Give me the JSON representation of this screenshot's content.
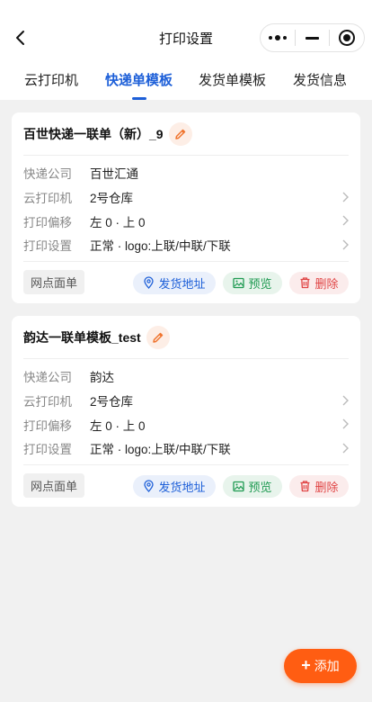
{
  "header": {
    "title": "打印设置"
  },
  "tabs": [
    {
      "label": "云打印机",
      "active": false
    },
    {
      "label": "快递单模板",
      "active": true
    },
    {
      "label": "发货单模板",
      "active": false
    },
    {
      "label": "发货信息",
      "active": false
    }
  ],
  "field_labels": {
    "courier": "快递公司",
    "printer": "云打印机",
    "offset": "打印偏移",
    "settings": "打印设置"
  },
  "templates": [
    {
      "title": "百世快递一联单（新）_9",
      "courier": "百世汇通",
      "printer": "2号仓库",
      "offset": "左 0 · 上 0",
      "settings": "正常 · logo:上联/中联/下联",
      "tag": "网点面单",
      "address_btn": "发货地址",
      "preview_btn": "预览",
      "delete_btn": "删除"
    },
    {
      "title": "韵达一联单模板_test",
      "courier": "韵达",
      "printer": "2号仓库",
      "offset": "左 0 · 上 0",
      "settings": "正常 · logo:上联/中联/下联",
      "tag": "网点面单",
      "address_btn": "发货地址",
      "preview_btn": "预览",
      "delete_btn": "删除"
    }
  ],
  "add_button": {
    "label": "添加"
  },
  "colors": {
    "accent": "#1d5fd8",
    "fab": "#ff5d12",
    "edit": "#f0742e",
    "preview": "#1f9a52",
    "delete": "#e04444"
  }
}
